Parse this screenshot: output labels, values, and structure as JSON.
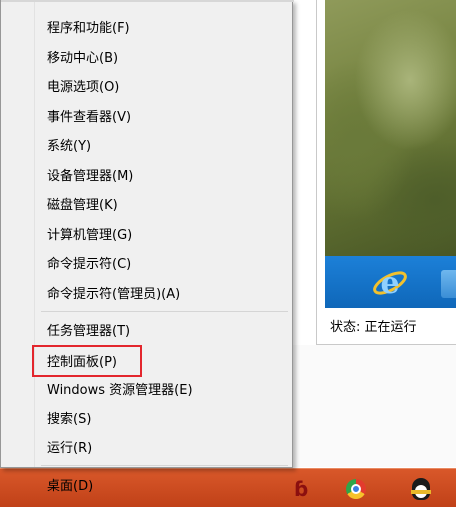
{
  "context_menu": {
    "items": [
      {
        "label": "程序和功能(F)"
      },
      {
        "label": "移动中心(B)"
      },
      {
        "label": "电源选项(O)"
      },
      {
        "label": "事件查看器(V)"
      },
      {
        "label": "系统(Y)"
      },
      {
        "label": "设备管理器(M)"
      },
      {
        "label": "磁盘管理(K)"
      },
      {
        "label": "计算机管理(G)"
      },
      {
        "label": "命令提示符(C)"
      },
      {
        "label": "命令提示符(管理员)(A)"
      },
      {
        "label": "任务管理器(T)"
      },
      {
        "label": "控制面板(P)"
      },
      {
        "label": "Windows 资源管理器(E)"
      },
      {
        "label": "搜索(S)"
      },
      {
        "label": "运行(R)"
      },
      {
        "label": "桌面(D)"
      }
    ],
    "highlighted_item": "控制面板(P)"
  },
  "background_window": {
    "status_text": "状态: 正在运行"
  },
  "taskbar": {
    "icons": [
      "red-glyph-icon",
      "chrome-icon",
      "qq-icon"
    ],
    "red_glyph": "ɓ"
  },
  "colors": {
    "taskbar": "#c9491e",
    "highlight_border": "#e3262d",
    "app_strip": "#1474c8"
  }
}
